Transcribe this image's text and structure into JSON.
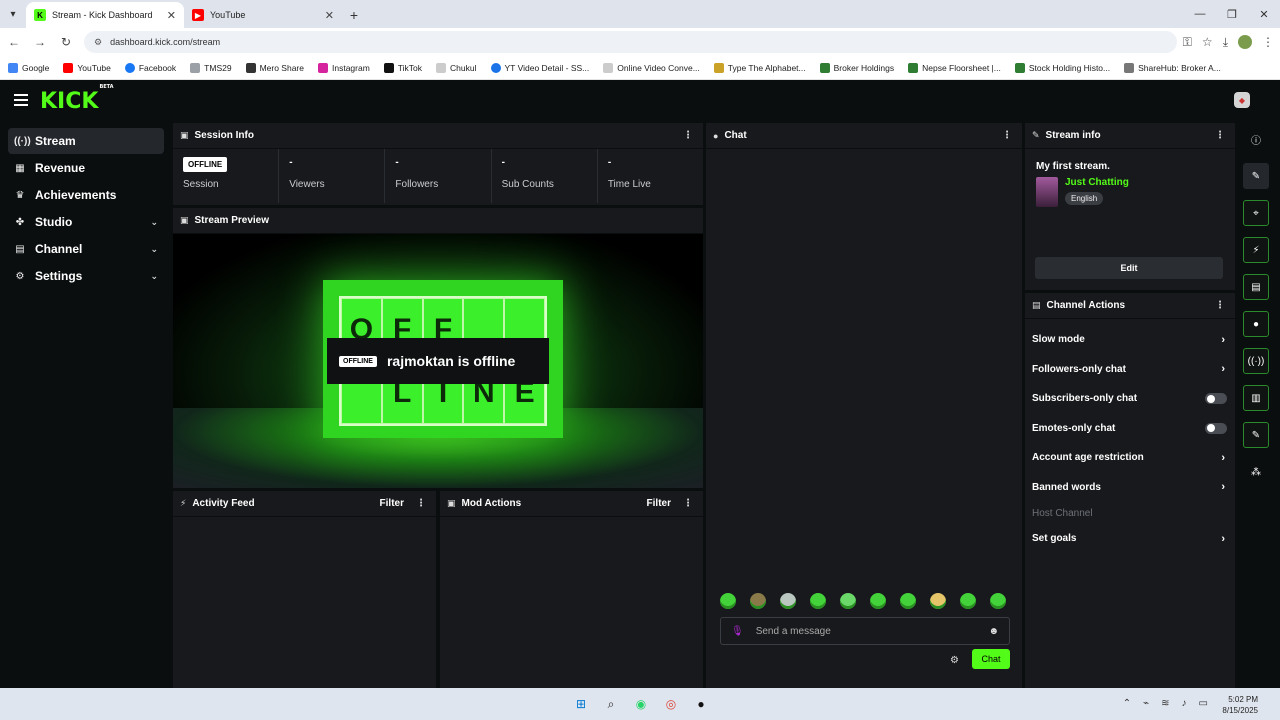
{
  "browser": {
    "tabs": [
      {
        "label": "Stream - Kick Dashboard",
        "active": true
      },
      {
        "label": "YouTube",
        "active": false
      }
    ],
    "url": "dashboard.kick.com/stream",
    "bookmarks": [
      "Google",
      "YouTube",
      "Facebook",
      "TMS29",
      "Mero Share",
      "Instagram",
      "TikTok",
      "Chukul",
      "YT Video Detail - SS...",
      "Online Video Conve...",
      "Type The Alphabet...",
      "Broker Holdings",
      "Nepse Floorsheet |...",
      "Stock Holding Histo...",
      "ShareHub: Broker A..."
    ]
  },
  "app": {
    "logo": "KICK",
    "logo_badge": "BETA",
    "sidebar": [
      {
        "label": "Stream",
        "icon": "stream-icon",
        "active": true,
        "expandable": false
      },
      {
        "label": "Revenue",
        "icon": "revenue-icon",
        "active": false,
        "expandable": false
      },
      {
        "label": "Achievements",
        "icon": "trophy-icon",
        "active": false,
        "expandable": false
      },
      {
        "label": "Studio",
        "icon": "studio-icon",
        "active": false,
        "expandable": true
      },
      {
        "label": "Channel",
        "icon": "channel-icon",
        "active": false,
        "expandable": true
      },
      {
        "label": "Settings",
        "icon": "gear-icon",
        "active": false,
        "expandable": true
      }
    ]
  },
  "session": {
    "title": "Session Info",
    "status_pill": "OFFLINE",
    "status_label": "Session",
    "stats": [
      {
        "value": "-",
        "label": "Viewers"
      },
      {
        "value": "-",
        "label": "Followers"
      },
      {
        "value": "-",
        "label": "Sub Counts"
      },
      {
        "value": "-",
        "label": "Time Live"
      }
    ]
  },
  "preview": {
    "title": "Stream Preview",
    "offline_pill": "OFFLINE",
    "offline_text": "rajmoktan is offline",
    "board_letters": [
      "O",
      "F",
      "F",
      "",
      "",
      "",
      "L",
      "I",
      "N",
      "E"
    ]
  },
  "activity": {
    "title": "Activity Feed",
    "filter": "Filter"
  },
  "mod": {
    "title": "Mod Actions",
    "filter": "Filter"
  },
  "chat": {
    "title": "Chat",
    "placeholder": "Send a message",
    "send_label": "Chat"
  },
  "stream_info": {
    "title": "Stream info",
    "stream_title": "My first stream.",
    "category": "Just Chatting",
    "language": "English",
    "edit_label": "Edit"
  },
  "channel_actions": {
    "title": "Channel Actions",
    "items": [
      {
        "label": "Slow mode",
        "kind": "arrow"
      },
      {
        "label": "Followers-only chat",
        "kind": "arrow"
      },
      {
        "label": "Subscribers-only chat",
        "kind": "toggle"
      },
      {
        "label": "Emotes-only chat",
        "kind": "toggle"
      },
      {
        "label": "Account age restriction",
        "kind": "arrow"
      },
      {
        "label": "Banned words",
        "kind": "arrow"
      },
      {
        "label": "Host Channel",
        "kind": "disabled"
      },
      {
        "label": "Set goals",
        "kind": "arrow"
      }
    ]
  },
  "taskbar": {
    "time": "5:02 PM",
    "date": "8/15/2025"
  },
  "colors": {
    "accent": "#53fc18",
    "panel": "#18191c",
    "background": "#0b0e0f"
  }
}
